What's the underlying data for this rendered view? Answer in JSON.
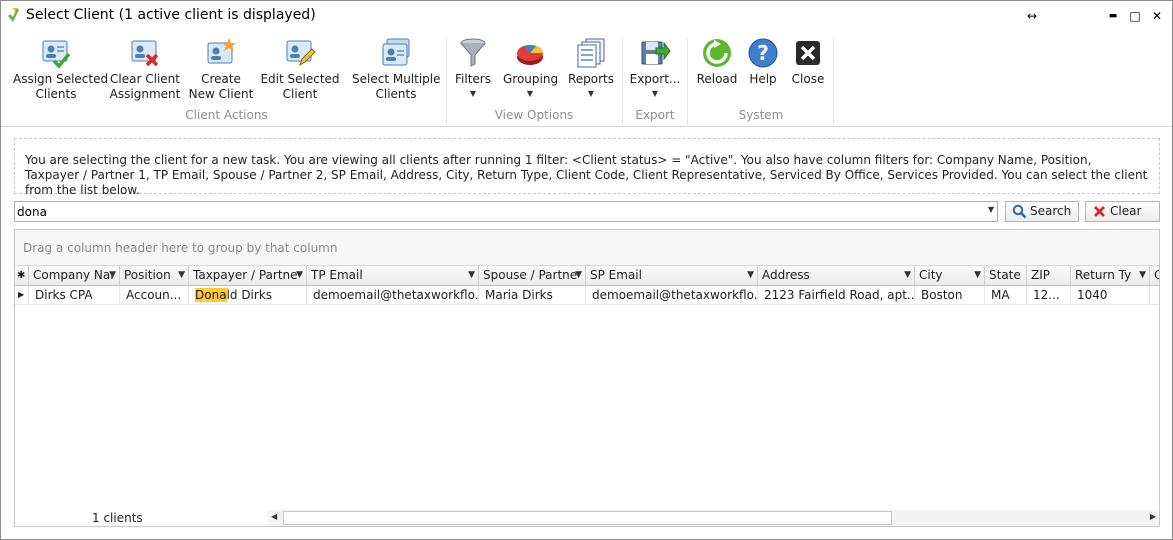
{
  "window": {
    "title": "Select Client (1 active client is displayed)"
  },
  "titlebar_buttons": {
    "restore": "↔",
    "minimize": "▬",
    "maximize": "□",
    "close": "✕"
  },
  "ribbon": {
    "buttons": [
      {
        "line1": "Assign Selected",
        "line2": "Clients",
        "icon": "assign-clients-icon"
      },
      {
        "line1": "Clear Client",
        "line2": "Assignment",
        "icon": "clear-assignment-icon"
      },
      {
        "line1": "Create",
        "line2": "New Client",
        "icon": "create-client-icon"
      },
      {
        "line1": "Edit Selected",
        "line2": "Client",
        "icon": "edit-client-icon"
      },
      {
        "line1": "Select Multiple",
        "line2": "Clients",
        "icon": "select-multiple-icon"
      },
      {
        "line1": "Filters",
        "line2": "",
        "icon": "filter-funnel-icon"
      },
      {
        "line1": "Grouping",
        "line2": "",
        "icon": "pie-chart-icon"
      },
      {
        "line1": "Reports",
        "line2": "",
        "icon": "reports-icon"
      },
      {
        "line1": "Export...",
        "line2": "",
        "icon": "export-icon"
      },
      {
        "line1": "Reload",
        "line2": "",
        "icon": "reload-icon"
      },
      {
        "line1": "Help",
        "line2": "",
        "icon": "help-icon"
      },
      {
        "line1": "Close",
        "line2": "",
        "icon": "close-icon"
      }
    ],
    "groups": [
      "Client Actions",
      "View Options",
      "Export",
      "System"
    ]
  },
  "info_text": "You are selecting the client for a new task. You are viewing all clients after running 1 filter: <Client status> = \"Active\". You also have column filters for: Company Name, Position, Taxpayer / Partner 1, TP Email, Spouse / Partner 2, SP Email, Address, City, Return Type, Client Code, Client Representative, Serviced By Office, Services Provided. You can select the client from the list below.",
  "search": {
    "value": "dona",
    "search_label": "Search",
    "clear_label": "Clear"
  },
  "grid": {
    "group_hint": "Drag a column header here to group by that column",
    "columns": [
      "Company Nar",
      "Position",
      "Taxpayer / Partne",
      "TP Email",
      "Spouse / Partne",
      "SP Email",
      "Address",
      "City",
      "State",
      "ZIP",
      "Return Ty",
      "C"
    ],
    "rows": [
      {
        "company": "Dirks CPA",
        "position": "Accoun...",
        "taxpayer_match": "Dona",
        "taxpayer_rest": "ld Dirks",
        "tp_email": "demoemail@thetaxworkflo...",
        "spouse": "Maria Dirks",
        "sp_email": "demoemail@thetaxworkflo...",
        "address": "2123 Fairfield Road, apt...",
        "city": "Boston",
        "state": "MA",
        "zip": "12...",
        "return_type": "1040"
      }
    ],
    "count": "1 clients"
  },
  "colors": {
    "highlight": "#ffcc33",
    "group_label": "#8e8e8e"
  }
}
